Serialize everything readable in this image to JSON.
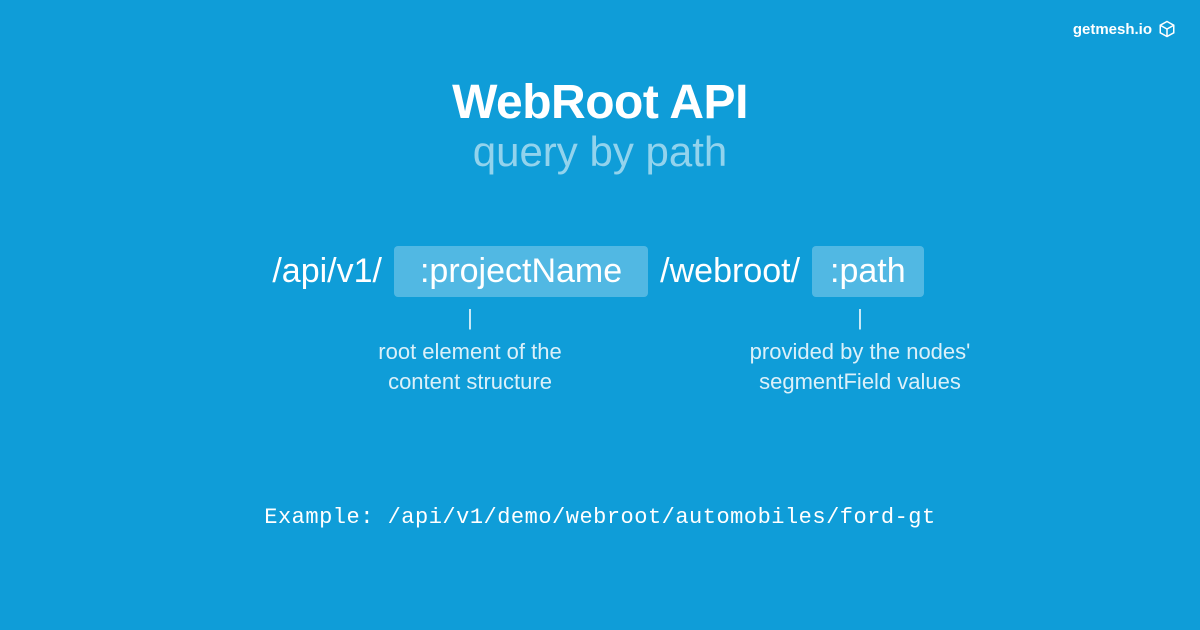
{
  "brand": {
    "label": "getmesh.io"
  },
  "header": {
    "title": "WebRoot API",
    "subtitle": "query by path"
  },
  "pattern": {
    "prefix": "/api/v1/",
    "param_project": ":projectName",
    "mid": "/webroot/",
    "param_path": ":path"
  },
  "annotations": {
    "project": {
      "line1": "root element of the",
      "line2": "content structure"
    },
    "path": {
      "line1": "provided by the nodes'",
      "line2": "segmentField values"
    },
    "tick": "|"
  },
  "example": {
    "label": "Example:",
    "value": "/api/v1/demo/webroot/automobiles/ford-gt"
  }
}
